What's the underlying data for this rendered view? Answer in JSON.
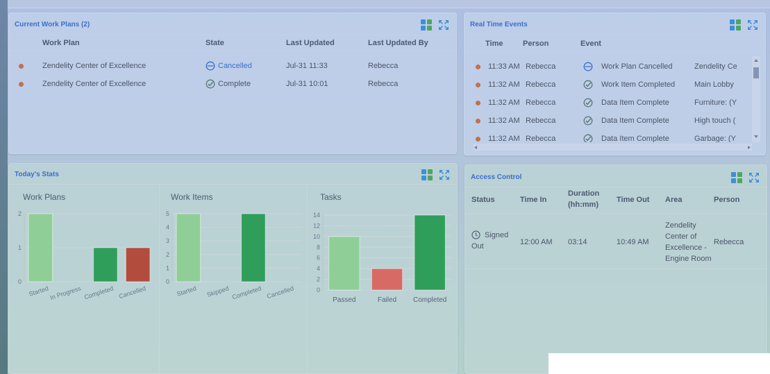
{
  "work_plans": {
    "title": "Current Work Plans (2)",
    "columns": [
      "Work Plan",
      "State",
      "Last Updated",
      "Last Updated By"
    ],
    "rows": [
      {
        "work_plan": "Zendelity Center of Excellence",
        "state": "Cancelled",
        "state_icon": "cancel-circle-icon",
        "last_updated": "Jul-31 11:33",
        "updated_by": "Rebecca"
      },
      {
        "work_plan": "Zendelity Center of Excellence",
        "state": "Complete",
        "state_icon": "check-circle-icon",
        "last_updated": "Jul-31 10:01",
        "updated_by": "Rebecca"
      }
    ]
  },
  "events": {
    "title": "Real Time Events",
    "columns": [
      "Time",
      "Person",
      "Event"
    ],
    "rows": [
      {
        "time": "11:33 AM",
        "person": "Rebecca",
        "icon": "cancel-circle-icon",
        "event": "Work Plan Cancelled",
        "detail": "Zendelity Ce"
      },
      {
        "time": "11:32 AM",
        "person": "Rebecca",
        "icon": "check-circle-icon",
        "event": "Work Item Completed",
        "detail": "Main Lobby"
      },
      {
        "time": "11:32 AM",
        "person": "Rebecca",
        "icon": "check-circle-icon",
        "event": "Data Item Complete",
        "detail": "Furniture: (Y"
      },
      {
        "time": "11:32 AM",
        "person": "Rebecca",
        "icon": "check-circle-icon",
        "event": "Data Item Complete",
        "detail": "High touch ("
      },
      {
        "time": "11:32 AM",
        "person": "Rebecca",
        "icon": "check-circle-icon",
        "event": "Data Item Complete",
        "detail": "Garbage: (Y"
      }
    ]
  },
  "stats": {
    "title": "Today's Stats"
  },
  "access": {
    "title": "Access Control",
    "columns": {
      "status": "Status",
      "time_in": "Time In",
      "duration_1": "Duration",
      "duration_2": "(hh:mm)",
      "time_out": "Time Out",
      "area": "Area",
      "person": "Person"
    },
    "row": {
      "status_1": "Signed",
      "status_2": "Out",
      "time_in": "12:00 AM",
      "duration": "03:14",
      "time_out": "10:49 AM",
      "area_lines": [
        "Zendelity",
        "Center of",
        "Excellence -",
        "Engine Room"
      ],
      "person": "Rebecca"
    }
  },
  "colors": {
    "light_green": "#8fcf97",
    "dark_green": "#2f9e5b",
    "red_dark": "#b24d3e",
    "red_light": "#d76a64",
    "accent": "#3b6fc9",
    "dot": "#c0714e"
  },
  "chart_data": [
    {
      "type": "bar",
      "title": "Work Plans",
      "categories": [
        "Started",
        "In Progress",
        "Completed",
        "Cancelled"
      ],
      "values": [
        2,
        0,
        1,
        1
      ],
      "ylim": [
        0,
        2
      ],
      "yticks": [
        0,
        1,
        2
      ],
      "colors": [
        "#8fcf97",
        "#8fcf97",
        "#2f9e5b",
        "#b24d3e"
      ],
      "grid": true
    },
    {
      "type": "bar",
      "title": "Work Items",
      "categories": [
        "Started",
        "Skipped",
        "Completed",
        "Cancelled"
      ],
      "values": [
        5,
        0,
        5,
        0
      ],
      "ylim": [
        0,
        5
      ],
      "yticks": [
        0,
        1,
        2,
        3,
        4,
        5
      ],
      "colors": [
        "#8fcf97",
        "#8fcf97",
        "#2f9e5b",
        "#b24d3e"
      ],
      "grid": true
    },
    {
      "type": "bar",
      "title": "Tasks",
      "categories": [
        "Passed",
        "Failed",
        "Completed"
      ],
      "values": [
        10,
        4,
        14
      ],
      "ylim": [
        0,
        14
      ],
      "yticks": [
        0,
        2,
        4,
        6,
        8,
        10,
        12,
        14
      ],
      "colors": [
        "#8fcf97",
        "#d76a64",
        "#2f9e5b"
      ],
      "grid": true
    }
  ]
}
